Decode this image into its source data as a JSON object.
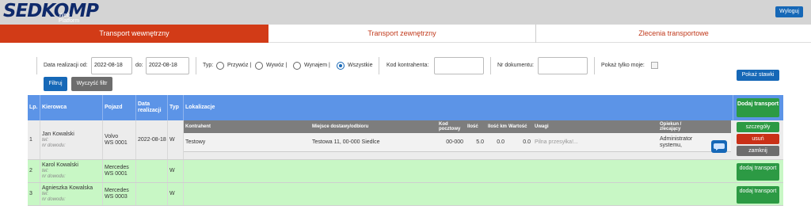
{
  "brand": {
    "logo_text": "SEDKOMP",
    "subtitle": "Web Platform"
  },
  "header": {
    "logout_label": "Wyloguj"
  },
  "tabs": [
    {
      "label": "Transport wewnętrzny",
      "active": true
    },
    {
      "label": "Transport zewnętrzny",
      "active": false
    },
    {
      "label": "Zlecenia transportowe",
      "active": false
    }
  ],
  "filters": {
    "date_from_label": "Data realizacji od:",
    "date_from_value": "2022-08-18",
    "date_to_label": "do:",
    "date_to_value": "2022-08-18",
    "type_label": "Typ:",
    "type_options": [
      {
        "label": "Przywóz |",
        "checked": false
      },
      {
        "label": "Wywóz |",
        "checked": false
      },
      {
        "label": "Wynajem |",
        "checked": false
      },
      {
        "label": "Wszystkie",
        "checked": true
      }
    ],
    "contractor_label": "Kod kontrahenta:",
    "contractor_value": "",
    "doc_label": "Nr dokumentu:",
    "doc_value": "",
    "only_mine_label": "Pokaż tylko moje:",
    "only_mine_checked": false,
    "filter_button": "Filtruj",
    "clear_button": "Wyczyść filtr",
    "rates_button": "Pokaż stawki"
  },
  "table": {
    "headers": [
      "Lp.",
      "Kierowca",
      "Pojazd",
      "Data realizacji",
      "Typ",
      "Lokalizacje"
    ],
    "add_transport_header": "Dodaj transport",
    "rows": [
      {
        "lp": "1",
        "driver": "Jan Kowalski",
        "phone": "tel:",
        "id_no": "nr dowodu:",
        "vehicle": "Volvo",
        "plate": "WS 0001",
        "date": "2022-08-18",
        "type": "W",
        "actions": {
          "details": "szczegóły",
          "delete": "usuń",
          "close": "zamknij"
        }
      },
      {
        "lp": "2",
        "driver": "Karol Kowalski",
        "phone": "tel:",
        "id_no": "nr dowodu:",
        "vehicle": "Mercedes",
        "plate": "WS 0001",
        "date": "",
        "type": "W",
        "actions": {
          "add": "dodaj transport"
        }
      },
      {
        "lp": "3",
        "driver": "Agnieszka Kowalska",
        "phone": "tel:",
        "id_no": "nr dowodu:",
        "vehicle": "Mercedes",
        "plate": "WS 0003",
        "date": "",
        "type": "W",
        "actions": {
          "add": "dodaj transport"
        }
      }
    ],
    "locations": {
      "headers": [
        "Kontrahent",
        "Miejsce dostawy/odbioru",
        "Kod pocztowy",
        "Ilość",
        "Ilość km",
        "Wartość",
        "Uwagi",
        "Opiekun / zlecający"
      ],
      "rows": [
        {
          "contractor": "Testowy",
          "place": "Testowa 11, 00-000 Siedlce",
          "postcode": "00-000",
          "qty": "5.0",
          "km": "0.0",
          "value": "0.0",
          "notes_placeholder": "Pilna przesyłka!...",
          "owner": "Administrator systemu,"
        }
      ]
    }
  },
  "colors": {
    "accent_red": "#d23b17",
    "primary_blue": "#1668b7",
    "header_blue": "#5c94e7",
    "success_green": "#2c9a44",
    "row_green": "#c8f7c5"
  }
}
